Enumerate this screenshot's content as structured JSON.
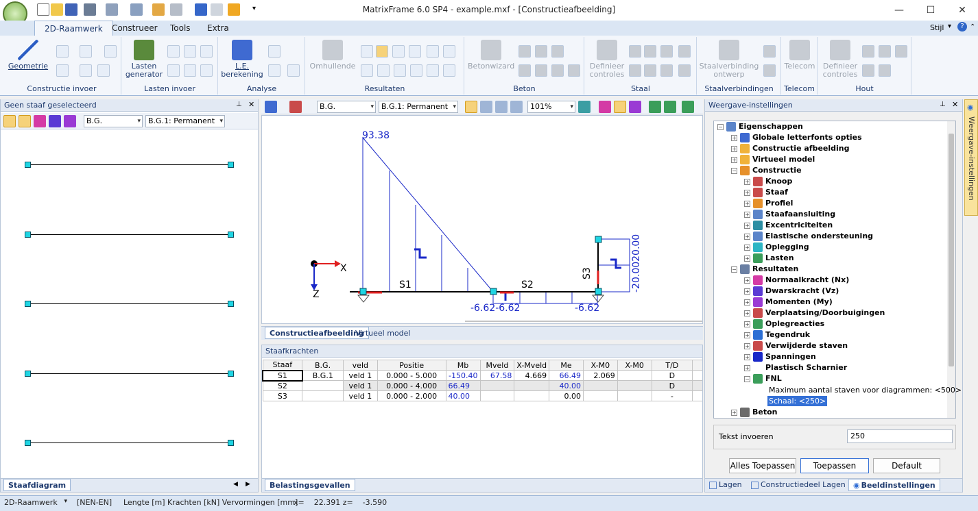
{
  "window": {
    "title": "MatrixFrame 6.0 SP4 - example.mxf - [Constructieafbeelding]"
  },
  "ribbon": {
    "tabs": [
      "2D-Raamwerk",
      "Construeer",
      "Tools",
      "Extra"
    ],
    "style_label": "Stijl",
    "groups": {
      "constructie_invoer": {
        "label": "Constructie invoer",
        "button": "Geometrie"
      },
      "lasten_invoer": {
        "label": "Lasten invoer",
        "button1": "Lasten",
        "button2": "generator"
      },
      "analyse": {
        "label": "Analyse",
        "button1": "L.E.",
        "button2": "berekening"
      },
      "resultaten": {
        "label": "Resultaten",
        "button": "Omhullende"
      },
      "beton": {
        "label": "Beton",
        "button": "Betonwizard"
      },
      "staal": {
        "label": "Staal",
        "button1": "Definieer",
        "button2": "controles"
      },
      "staalverbindingen": {
        "label": "Staalverbindingen",
        "button1": "Staalverbinding",
        "button2": "ontwerp"
      },
      "telecom": {
        "label": "Telecom",
        "button": "Telecom"
      },
      "hout": {
        "label": "Hout",
        "button1": "Definieer",
        "button2": "controles"
      }
    }
  },
  "left_panel": {
    "title": "Geen staaf geselecteerd",
    "select_bg": "B.G.",
    "select_case": "B.G.1: Permanent",
    "bottom_tab": "Staafdiagram",
    "members": 5
  },
  "view": {
    "select_bg": "B.G.",
    "select_case": "B.G.1: Permanent",
    "zoom": "101%",
    "diagram": {
      "max_label": "93.38",
      "s1_label": "S1",
      "s2_label": "S2",
      "s3_label": "S3",
      "label_neg1": "-6.62-6.62",
      "label_neg2": "-6.62",
      "label_s3": "-20.0020.00",
      "axis_x": "X",
      "axis_z": "Z"
    },
    "tabs": [
      "Constructieafbeelding",
      "Virtueel model"
    ]
  },
  "staafkrachten": {
    "title": "Staafkrachten",
    "columns": [
      "Staaf",
      "B.G.",
      "veld",
      "Positie",
      "Mb",
      "Mveld",
      "X-Mveld",
      "Me",
      "X-M0",
      "X-M0",
      "T/D"
    ],
    "rows": [
      [
        "S1",
        "B.G.1",
        "veld 1",
        "0.000 - 5.000",
        "-150.40",
        "67.58",
        "4.669",
        "66.49",
        "2.069",
        "",
        "D"
      ],
      [
        "S2",
        "",
        "veld 1",
        "0.000 - 4.000",
        "66.49",
        "",
        "",
        "40.00",
        "",
        "",
        "D"
      ],
      [
        "S3",
        "",
        "veld 1",
        "0.000 - 2.000",
        "40.00",
        "",
        "",
        "0.00",
        "",
        "",
        "-"
      ]
    ],
    "bottom_tab": "Belastingsgevallen"
  },
  "right_panel": {
    "title": "Weergave-instellingen",
    "vertical_tab": "Weergave-instellingen",
    "tree": {
      "root": "Eigenschappen",
      "items": [
        "Globale letterfonts opties",
        "Constructie afbeelding",
        "Virtueel model",
        "Constructie"
      ],
      "constructie_children": [
        "Knoop",
        "Staaf",
        "Profiel",
        "Staafaansluiting",
        "Excentriciteiten",
        "Elastische ondersteuning",
        "Oplegging",
        "Lasten"
      ],
      "resultaten": "Resultaten",
      "resultaten_children": [
        "Normaalkracht (Nx)",
        "Dwarskracht (Vz)",
        "Momenten (My)",
        "Verplaatsing/Doorbuigingen",
        "Oplegreacties",
        "Tegendruk",
        "Verwijderde staven",
        "Spanningen",
        "Plastisch Scharnier",
        "FNL"
      ],
      "max_line": "Maximum aantal staven voor diagrammen: <500>",
      "scale_line": "Schaal: <250>",
      "beton": "Beton"
    },
    "text_input_label": "Tekst invoeren",
    "text_input_value": "250",
    "buttons": {
      "apply_all": "Alles Toepassen",
      "apply": "Toepassen",
      "default": "Default"
    },
    "bottom_tabs": [
      "Lagen",
      "Constructiedeel Lagen",
      "Beeldinstellingen"
    ]
  },
  "statusbar": {
    "mode": "2D-Raamwerk",
    "norm": "[NEN-EN]",
    "units": "Lengte [m] Krachten [kN] Vervormingen [mm]",
    "coords": "x=    22.391 z=    -3.590"
  }
}
